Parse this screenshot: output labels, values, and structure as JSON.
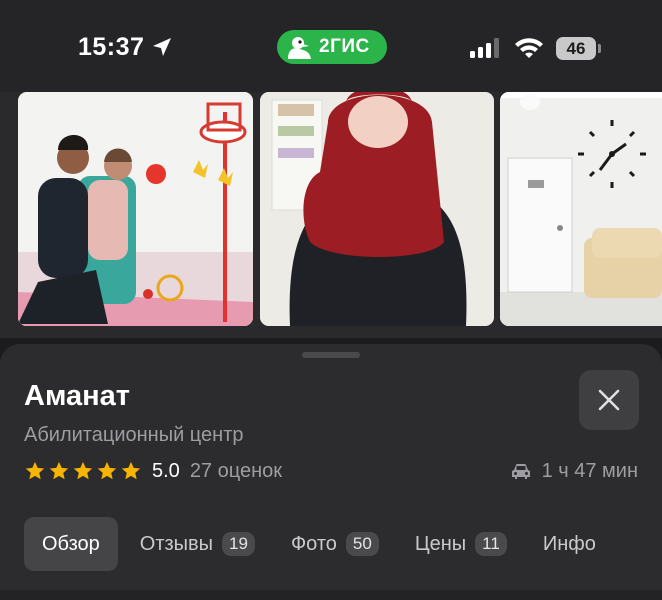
{
  "status_bar": {
    "time": "15:37",
    "brand": "2ГИС",
    "battery": "46"
  },
  "place": {
    "name": "Аманат",
    "category": "Абилитационный центр",
    "rating": "5.0",
    "rating_stars": 5,
    "reviews_count": "27 оценок",
    "travel_time": "1 ч 47 мин"
  },
  "tabs": [
    {
      "label": "Обзор",
      "badge": ""
    },
    {
      "label": "Отзывы",
      "badge": "19"
    },
    {
      "label": "Фото",
      "badge": "50"
    },
    {
      "label": "Цены",
      "badge": "11"
    },
    {
      "label": "Инфо",
      "badge": ""
    }
  ],
  "colors": {
    "brand_green": "#2bb44a",
    "star": "#f7b500",
    "sheet": "#2c2c2e"
  },
  "icons": [
    "location-arrow-icon",
    "signal-icon",
    "wifi-icon",
    "battery-icon",
    "close-icon",
    "star-icon",
    "car-icon"
  ]
}
